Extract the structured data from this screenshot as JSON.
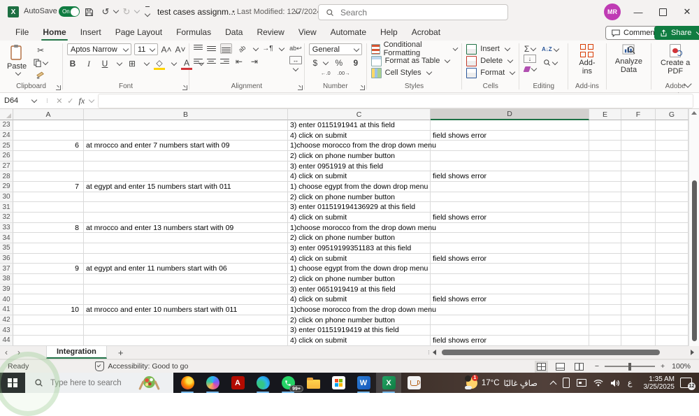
{
  "titlebar": {
    "autosave_label": "AutoSave",
    "autosave_state": "On",
    "doc_title": "test cases assignm...",
    "last_modified": "• Last Modified: 12/7/2024",
    "search_placeholder": "Search",
    "avatar_initials": "MR"
  },
  "menubar": {
    "tabs": [
      "File",
      "Home",
      "Insert",
      "Page Layout",
      "Formulas",
      "Data",
      "Review",
      "View",
      "Automate",
      "Help",
      "Acrobat"
    ],
    "active_tab": "Home",
    "comments_label": "Comments",
    "share_label": "Share"
  },
  "ribbon": {
    "paste_label": "Paste",
    "font_name": "Aptos Narrow",
    "font_size": "11",
    "number_format": "General",
    "style_buttons": [
      "Conditional Formatting",
      "Format as Table",
      "Cell Styles"
    ],
    "cell_buttons": [
      "Insert",
      "Delete",
      "Format"
    ],
    "addins_label": "Add-ins",
    "analyze_label": "Analyze Data",
    "pdf_label": "Create a PDF",
    "group_labels": {
      "clipboard": "Clipboard",
      "font": "Font",
      "alignment": "Alignment",
      "number": "Number",
      "styles": "Styles",
      "cells": "Cells",
      "editing": "Editing",
      "addins": "Add-ins",
      "acrobat": "Adobe Acrobat"
    },
    "icons": {
      "undo": "↺",
      "redo": "↻",
      "cut": "✂",
      "bold": "B",
      "italic": "I",
      "underline": "U",
      "borders": "⊞",
      "fill_color": "◇",
      "font_color": "A",
      "grow_font": "A˄",
      "shrink_font": "A˅",
      "dollar": "$",
      "percent": "%",
      "comma": "9",
      "dec_left": "←.0",
      "dec_right": ".00→",
      "sum": "Σ",
      "sort": "A↓Z",
      "wrap": "ab↩",
      "orient": "ab",
      "direction": "→¶",
      "merge": "↔",
      "indent_l": "⇤",
      "indent_r": "⇥",
      "fill_down": "↓"
    }
  },
  "formula_bar": {
    "name_box": "D64",
    "fx_label": "fx",
    "value": ""
  },
  "grid": {
    "columns": [
      "A",
      "B",
      "C",
      "D",
      "E",
      "F",
      "G"
    ],
    "selected_column": "D",
    "accent_green": "#1e7145",
    "rows": [
      {
        "n": "23",
        "a": "",
        "b": "",
        "c": "3) enter 0115191941 at this field",
        "d": ""
      },
      {
        "n": "24",
        "a": "",
        "b": "",
        "c": "4) click on submit",
        "d": "field shows error"
      },
      {
        "n": "25",
        "a": "6",
        "b": "at mrocco and enter 7 numbers start with 09",
        "c": "1)choose morocco from the drop down menu",
        "d": ""
      },
      {
        "n": "26",
        "a": "",
        "b": "",
        "c": "2) click on phone number button",
        "d": ""
      },
      {
        "n": "27",
        "a": "",
        "b": "",
        "c": "3) enter 0951919 at this field",
        "d": ""
      },
      {
        "n": "28",
        "a": "",
        "b": "",
        "c": "4) click on submit",
        "d": "field shows error"
      },
      {
        "n": "29",
        "a": "7",
        "b": "at egypt and enter 15 numbers start with 011",
        "c": "1) choose egypt from the down drop menu",
        "d": ""
      },
      {
        "n": "30",
        "a": "",
        "b": "",
        "c": "2) click on phone number button",
        "d": ""
      },
      {
        "n": "31",
        "a": "",
        "b": "",
        "c": "3) enter 011519194136929 at this field",
        "d": ""
      },
      {
        "n": "32",
        "a": "",
        "b": "",
        "c": "4) click on submit",
        "d": "field shows error"
      },
      {
        "n": "33",
        "a": "8",
        "b": "at mrocco and enter 13 numbers start with 09",
        "c": "1)choose morocco from the drop down menu",
        "d": ""
      },
      {
        "n": "34",
        "a": "",
        "b": "",
        "c": "2) click on phone number button",
        "d": ""
      },
      {
        "n": "35",
        "a": "",
        "b": "",
        "c": "3) enter 09519199351183 at this field",
        "d": ""
      },
      {
        "n": "36",
        "a": "",
        "b": "",
        "c": "4) click on submit",
        "d": "field shows error"
      },
      {
        "n": "37",
        "a": "9",
        "b": "at egypt and enter 11 numbers start with 06",
        "c": "1) choose egypt from the down drop menu",
        "d": ""
      },
      {
        "n": "38",
        "a": "",
        "b": "",
        "c": "2) click on phone number button",
        "d": ""
      },
      {
        "n": "39",
        "a": "",
        "b": "",
        "c": "3) enter 0651919419 at this field",
        "d": ""
      },
      {
        "n": "40",
        "a": "",
        "b": "",
        "c": "4) click on submit",
        "d": "field shows error"
      },
      {
        "n": "41",
        "a": "10",
        "b": "at mrocco and enter 10 numbers start with 011",
        "c": "1)choose morocco from the drop down menu",
        "d": ""
      },
      {
        "n": "42",
        "a": "",
        "b": "",
        "c": "2) click on phone number button",
        "d": ""
      },
      {
        "n": "43",
        "a": "",
        "b": "",
        "c": "3) enter 01151919419 at this field",
        "d": ""
      },
      {
        "n": "44",
        "a": "",
        "b": "",
        "c": "4) click on submit",
        "d": "field shows error"
      }
    ]
  },
  "sheet_tabs": {
    "active_tab": "Integration",
    "add_label": "+"
  },
  "status_bar": {
    "mode": "Ready",
    "accessibility": "Accessibility: Good to go",
    "zoom": "100%"
  },
  "taskbar": {
    "search_placeholder": "Type here to search",
    "apps": [
      {
        "name": "firefox",
        "underline": true
      },
      {
        "name": "copilot",
        "underline": true
      },
      {
        "name": "acrobat",
        "underline": false
      },
      {
        "name": "edge",
        "underline": true
      },
      {
        "name": "whatsapp",
        "underline": true,
        "badge": "99+"
      },
      {
        "name": "explorer",
        "underline": false
      },
      {
        "name": "store",
        "underline": false
      },
      {
        "name": "word",
        "underline": true
      },
      {
        "name": "excel",
        "underline": true,
        "active": true
      },
      {
        "name": "java",
        "underline": false
      }
    ],
    "weather": {
      "badge": "1",
      "temp": "17°C",
      "condition": "صافٍ غالبًا"
    },
    "language_indicator": "ع",
    "clock_time": "1:35 AM",
    "clock_date": "3/25/2025",
    "notification_count": "12"
  }
}
